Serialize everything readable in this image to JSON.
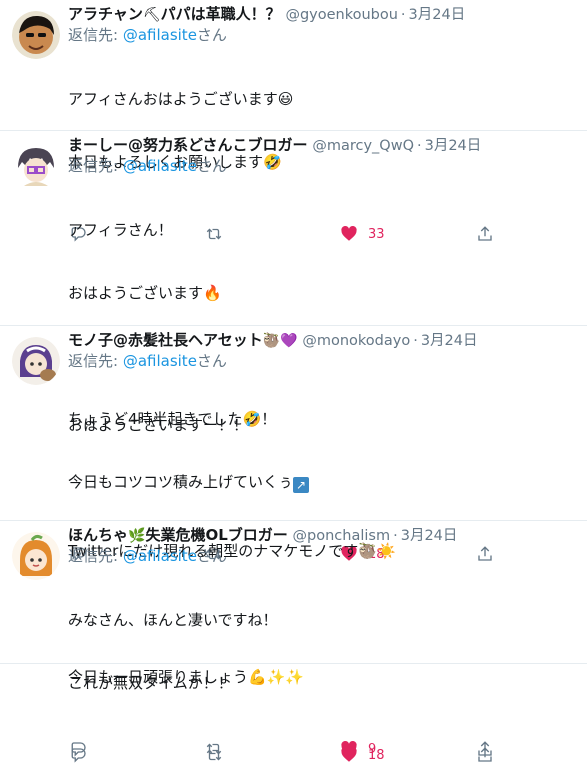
{
  "tweets": [
    {
      "name": "アラチャン",
      "name_emoji": "⛏",
      "name_suffix": "パパは革職人！？",
      "handle": "@gyoenkoubou",
      "time": "3月24日",
      "reply_prefix": "返信先: ",
      "reply_to": "@afilasite",
      "reply_suffix": "さん",
      "lines": [
        "アフィさんおはようございます😃",
        "本日もよろしくお願いします🤣"
      ],
      "likes": "33"
    },
    {
      "name": "まーしー@努力系どさんこブロガー",
      "handle": "@marcy_QwQ",
      "time": "3月24日",
      "reply_prefix": "返信先: ",
      "reply_to": "@afilasite",
      "reply_suffix": "さん",
      "lines": [
        "アフィラさん！",
        "おはようございます🔥",
        "",
        "ちょうど4時半起きでした🤣！",
        "今日もコツコツ積み上げていくぅ",
        "↗"
      ],
      "likes": "18"
    },
    {
      "name": "モノ子@赤髪社長ヘアセット",
      "name_emoji": "🦥💜",
      "handle": "@monokodayo",
      "time": "3月24日",
      "reply_prefix": "返信先: ",
      "reply_to": "@afilasite",
      "reply_suffix": "さん",
      "lines": [
        "おはようございますー！！",
        "",
        "Twitterにだけ現れる朝型のナマケモノです🦥☀️",
        "",
        "今日も一日頑張りましょう💪✨✨"
      ],
      "likes": "9"
    },
    {
      "name": "ほんちゃ",
      "name_emoji": "🌿",
      "name_suffix": "失業危機OLブロガー",
      "handle": "@ponchalism",
      "time": "3月24日",
      "reply_prefix": "返信先: ",
      "reply_to": "@afilasite",
      "reply_suffix": "さん",
      "lines": [
        "みなさん、ほんと凄いですね！",
        "これが無双タイムか！！"
      ],
      "likes": "18"
    }
  ],
  "icons": {
    "reply": "reply-icon",
    "retweet": "retweet-icon",
    "like": "heart-icon",
    "share": "share-icon"
  },
  "colors": {
    "like": "#e0245e",
    "link": "#1b95e0",
    "muted": "#657786",
    "border": "#e6ecf0"
  }
}
